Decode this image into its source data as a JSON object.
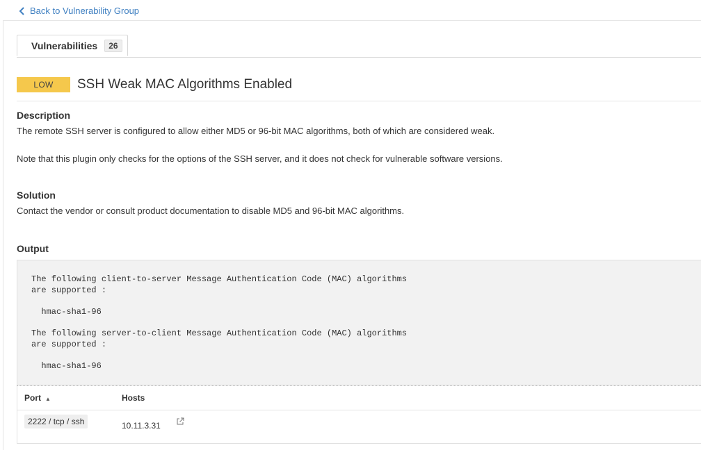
{
  "nav": {
    "back_label": "Back to Vulnerability Group"
  },
  "tabs": [
    {
      "label": "Vulnerabilities",
      "count": "26"
    }
  ],
  "vulnerability": {
    "severity": "LOW",
    "severity_color": "#f5c84c",
    "title": "SSH Weak MAC Algorithms Enabled"
  },
  "description": {
    "heading": "Description",
    "paragraphs": [
      "The remote SSH server is configured to allow either MD5 or 96-bit MAC algorithms, both of which are considered weak.",
      "Note that this plugin only checks for the options of the SSH server, and it does not check for vulnerable software versions."
    ]
  },
  "solution": {
    "heading": "Solution",
    "text": "Contact the vendor or consult product documentation to disable MD5 and 96-bit MAC algorithms."
  },
  "output": {
    "heading": "Output",
    "text": "The following client-to-server Message Authentication Code (MAC) algorithms\nare supported :\n\n  hmac-sha1-96\n\nThe following server-to-client Message Authentication Code (MAC) algorithms\nare supported :\n\n  hmac-sha1-96"
  },
  "table": {
    "columns": {
      "port": "Port",
      "hosts": "Hosts"
    },
    "rows": [
      {
        "port": "2222 / tcp / ssh",
        "host": "10.11.3.31"
      }
    ]
  },
  "icons": {
    "back": "chevron-left-icon",
    "sort": "sort-ascending-icon",
    "external": "external-link-icon"
  }
}
